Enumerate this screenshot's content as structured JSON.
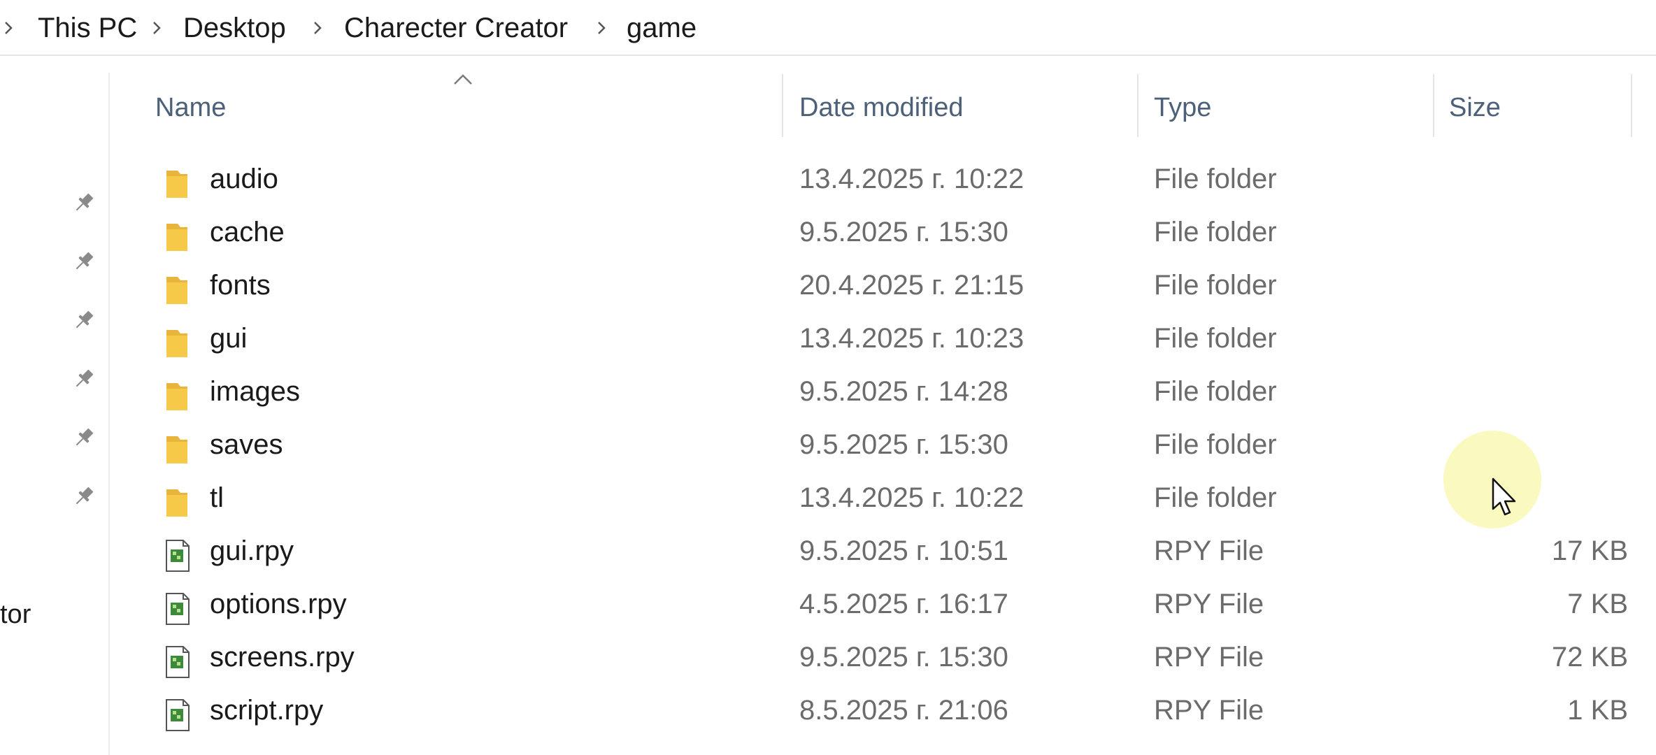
{
  "breadcrumb": {
    "items": [
      "This PC",
      "Desktop",
      "Charecter Creator",
      "game"
    ]
  },
  "nav_pane": {
    "partial_label": "tor",
    "pinned_count": 6
  },
  "columns": {
    "name": "Name",
    "date_modified": "Date modified",
    "type": "Type",
    "size": "Size"
  },
  "sort": {
    "column": "name",
    "direction": "ascending"
  },
  "files": [
    {
      "name": "audio",
      "date": "13.4.2025 г. 10:22",
      "type": "File folder",
      "size": "",
      "kind": "folder-icon"
    },
    {
      "name": "cache",
      "date": "9.5.2025 г. 15:30",
      "type": "File folder",
      "size": "",
      "kind": "folder-icon"
    },
    {
      "name": "fonts",
      "date": "20.4.2025 г. 21:15",
      "type": "File folder",
      "size": "",
      "kind": "folder-icon"
    },
    {
      "name": "gui",
      "date": "13.4.2025 г. 10:23",
      "type": "File folder",
      "size": "",
      "kind": "folder-icon"
    },
    {
      "name": "images",
      "date": "9.5.2025 г. 14:28",
      "type": "File folder",
      "size": "",
      "kind": "folder-icon"
    },
    {
      "name": "saves",
      "date": "9.5.2025 г. 15:30",
      "type": "File folder",
      "size": "",
      "kind": "folder-icon"
    },
    {
      "name": "tl",
      "date": "13.4.2025 г. 10:22",
      "type": "File folder",
      "size": "",
      "kind": "folder-icon"
    },
    {
      "name": "gui.rpy",
      "date": "9.5.2025 г. 10:51",
      "type": "RPY File",
      "size": "17 KB",
      "kind": "rpy-file-icon"
    },
    {
      "name": "options.rpy",
      "date": "4.5.2025 г. 16:17",
      "type": "RPY File",
      "size": "7 KB",
      "kind": "rpy-file-icon"
    },
    {
      "name": "screens.rpy",
      "date": "9.5.2025 г. 15:30",
      "type": "RPY File",
      "size": "72 KB",
      "kind": "rpy-file-icon"
    },
    {
      "name": "script.rpy",
      "date": "8.5.2025 г. 21:06",
      "type": "RPY File",
      "size": "1 KB",
      "kind": "rpy-file-icon"
    }
  ],
  "colors": {
    "folder": "#f7c948",
    "header_text": "#4c607a",
    "cursor_highlight": "#faf8b9"
  }
}
